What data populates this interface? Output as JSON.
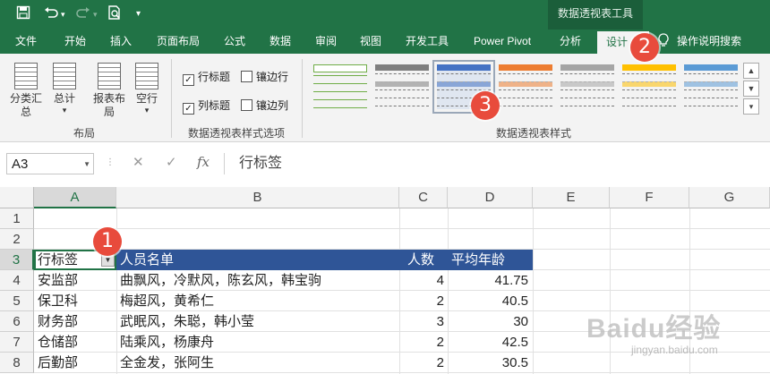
{
  "title_bar": {
    "icons": [
      "save-icon",
      "undo-icon",
      "redo-icon",
      "print-preview-icon",
      "customize-qat-icon"
    ],
    "context_group": "数据透视表工具"
  },
  "tabs": [
    {
      "label": "文件"
    },
    {
      "label": "开始"
    },
    {
      "label": "插入"
    },
    {
      "label": "页面布局"
    },
    {
      "label": "公式"
    },
    {
      "label": "数据"
    },
    {
      "label": "审阅"
    },
    {
      "label": "视图"
    },
    {
      "label": "开发工具"
    },
    {
      "label": "Power Pivot"
    },
    {
      "label": "分析"
    },
    {
      "label": "设计",
      "active": true
    },
    {
      "label": "操作说明搜索"
    }
  ],
  "tell_me_icon": "lightbulb-icon",
  "ribbon": {
    "layout_group": {
      "label": "布局",
      "buttons": [
        {
          "label": "分类汇总",
          "icon": "subtotals-icon"
        },
        {
          "label": "总计",
          "icon": "grand-totals-icon"
        },
        {
          "label": "报表布局",
          "icon": "report-layout-icon"
        },
        {
          "label": "空行",
          "icon": "blank-rows-icon"
        }
      ]
    },
    "options_group": {
      "label": "数据透视表样式选项",
      "checkboxes": [
        {
          "label": "行标题",
          "checked": true
        },
        {
          "label": "镶边行",
          "checked": false
        },
        {
          "label": "列标题",
          "checked": true
        },
        {
          "label": "镶边列",
          "checked": false
        }
      ]
    },
    "styles_group": {
      "label": "数据透视表样式",
      "swatches": [
        {
          "color": "#70ad47",
          "selected": false
        },
        {
          "color": "#7f7f7f",
          "selected": false
        },
        {
          "color": "#4472c4",
          "selected": true
        },
        {
          "color": "#ed7d31",
          "selected": false
        },
        {
          "color": "#a5a5a5",
          "selected": false
        },
        {
          "color": "#ffc000",
          "selected": false
        },
        {
          "color": "#5b9bd5",
          "selected": false
        }
      ]
    }
  },
  "formula_bar": {
    "name_box": "A3",
    "formula": "行标签",
    "icons": [
      "cancel-icon",
      "enter-icon",
      "insert-function-icon"
    ]
  },
  "sheet": {
    "columns": [
      "A",
      "B",
      "C",
      "D",
      "E",
      "F",
      "G"
    ],
    "rows": [
      "1",
      "2",
      "3",
      "4",
      "5",
      "6",
      "7",
      "8"
    ],
    "header_row": {
      "a": "行标签",
      "b": "人员名单",
      "c": "人数",
      "d": "平均年龄"
    },
    "data_rows": [
      {
        "a": "安监部",
        "b": "曲飘风，冷默风，陈玄风，韩宝驹",
        "c": "4",
        "d": "41.75"
      },
      {
        "a": "保卫科",
        "b": "梅超风，黄希仁",
        "c": "2",
        "d": "40.5"
      },
      {
        "a": "财务部",
        "b": "武眠风，朱聪，韩小莹",
        "c": "3",
        "d": "30"
      },
      {
        "a": "仓储部",
        "b": "陆乘风，杨康舟",
        "c": "2",
        "d": "42.5"
      },
      {
        "a": "后勤部",
        "b": "全金发，张阿生",
        "c": "2",
        "d": "30.5"
      }
    ],
    "header_band_color": "#2f5597"
  },
  "callouts": [
    "1",
    "2",
    "3"
  ],
  "watermark": {
    "logo": "Baidu经验",
    "url": "jingyan.baidu.com"
  }
}
